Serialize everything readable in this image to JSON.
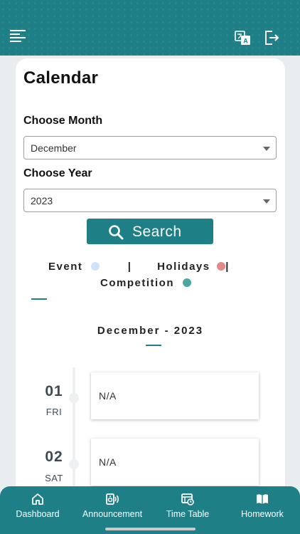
{
  "header": {
    "menu_icon": "menu-icon",
    "translate_icon": "translate-icon",
    "logout_icon": "logout-icon"
  },
  "main": {
    "title": "Calendar",
    "month_label": "Choose Month",
    "month_value": "December",
    "year_label": "Choose Year",
    "year_value": "2023",
    "search_label": "Search",
    "legend": {
      "event": "Event",
      "holidays": "Holidays",
      "competition": "Competition",
      "separator": "|",
      "colors": {
        "event": "#cfe4f6",
        "holidays": "#e08a8a",
        "competition": "#4aa7a1"
      }
    },
    "month_heading": "December - 2023",
    "days": [
      {
        "num": "01",
        "name": "FRI",
        "text": "N/A"
      },
      {
        "num": "02",
        "name": "SAT",
        "text": "N/A"
      }
    ]
  },
  "nav": {
    "items": [
      {
        "label": "Dashboard",
        "icon": "home-icon"
      },
      {
        "label": "Announcement",
        "icon": "announcement-icon"
      },
      {
        "label": "Time Table",
        "icon": "timetable-icon"
      },
      {
        "label": "Homework",
        "icon": "book-icon"
      }
    ]
  },
  "theme": {
    "accent": "#1f7f86"
  }
}
